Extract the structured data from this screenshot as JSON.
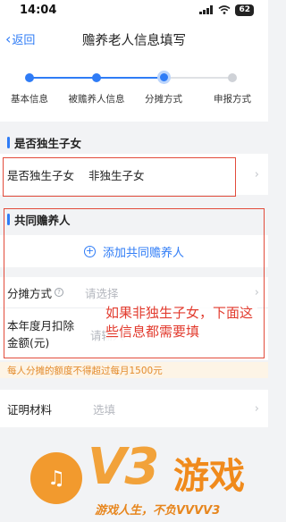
{
  "status_bar": {
    "time": "14:04",
    "battery": "62"
  },
  "nav": {
    "back_label": "返回",
    "title": "赡养老人信息填写"
  },
  "steps": [
    {
      "label": "基本信息",
      "state": "done"
    },
    {
      "label": "被赡养人信息",
      "state": "done"
    },
    {
      "label": "分摊方式",
      "state": "current"
    },
    {
      "label": "申报方式",
      "state": "todo"
    }
  ],
  "only_child_section": {
    "title": "是否独生子女",
    "row_label": "是否独生子女",
    "row_value": "非独生子女"
  },
  "co_supporters_section": {
    "title": "共同赡养人",
    "add_label": "添加共同赡养人"
  },
  "split_method": {
    "label": "分摊方式",
    "placeholder": "请选择"
  },
  "monthly_deduction": {
    "label_line1": "本年度月扣除",
    "label_line2": "金额(元)",
    "placeholder": "请输入"
  },
  "annotation": "如果非独生子女，下面这些信息都需要填",
  "notice": "每人分摊的额度不得超过每月1500元",
  "proof": {
    "label": "证明材料",
    "placeholder": "选填"
  },
  "watermark": {
    "brand": "V3",
    "brand_cn": "游戏",
    "tagline": "游戏人生，不负VVVV3"
  },
  "colors": {
    "accent": "#2f7cf6",
    "annotation": "#e23b2e",
    "notice_text": "#e38a2a"
  }
}
